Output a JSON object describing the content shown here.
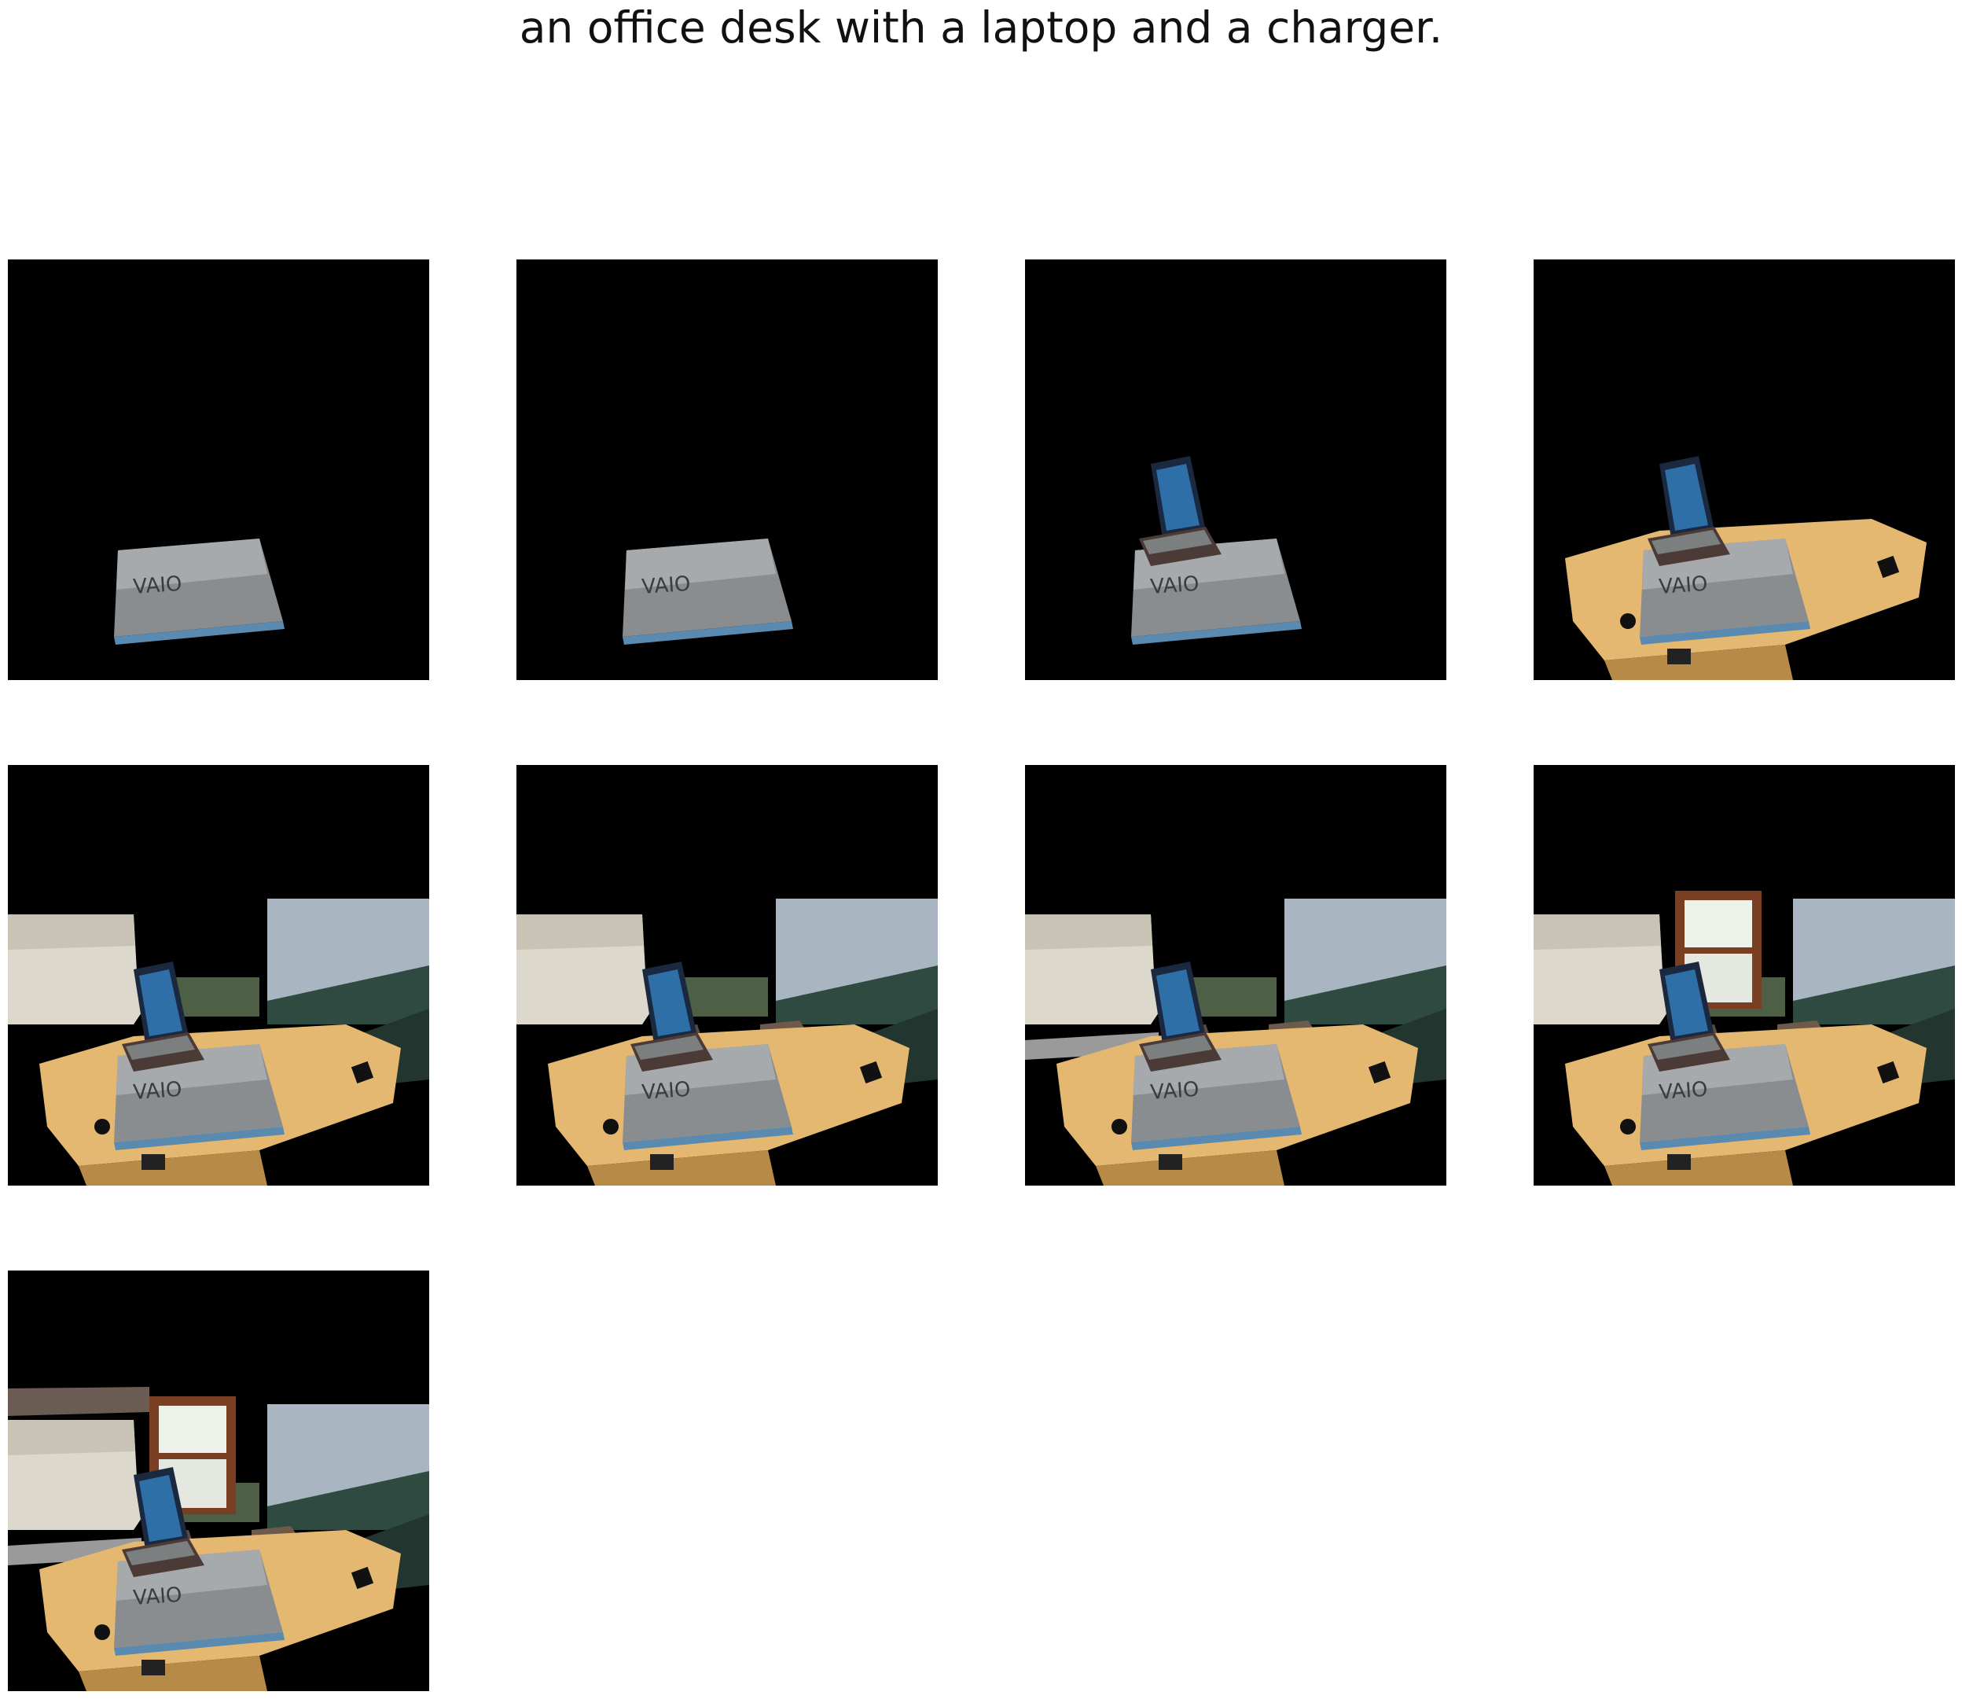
{
  "caption": "an office desk with a laptop and a charger.",
  "panels": [
    {
      "step": 1,
      "layers": [
        "closed-laptop"
      ]
    },
    {
      "step": 2,
      "layers": [
        "closed-laptop"
      ]
    },
    {
      "step": 3,
      "layers": [
        "closed-laptop",
        "open-laptop"
      ]
    },
    {
      "step": 4,
      "layers": [
        "closed-laptop",
        "open-laptop",
        "desk"
      ]
    },
    {
      "step": 5,
      "layers": [
        "closed-laptop",
        "open-laptop",
        "desk",
        "walls"
      ]
    },
    {
      "step": 6,
      "layers": [
        "closed-laptop",
        "open-laptop",
        "desk",
        "walls",
        "debris"
      ]
    },
    {
      "step": 7,
      "layers": [
        "closed-laptop",
        "open-laptop",
        "desk",
        "walls",
        "debris",
        "floor-strip"
      ]
    },
    {
      "step": 8,
      "layers": [
        "closed-laptop",
        "open-laptop",
        "desk",
        "walls",
        "debris",
        "window"
      ]
    },
    {
      "step": 9,
      "layers": [
        "closed-laptop",
        "open-laptop",
        "desk",
        "walls",
        "debris",
        "floor-strip",
        "window",
        "ceiling-beam"
      ]
    }
  ]
}
